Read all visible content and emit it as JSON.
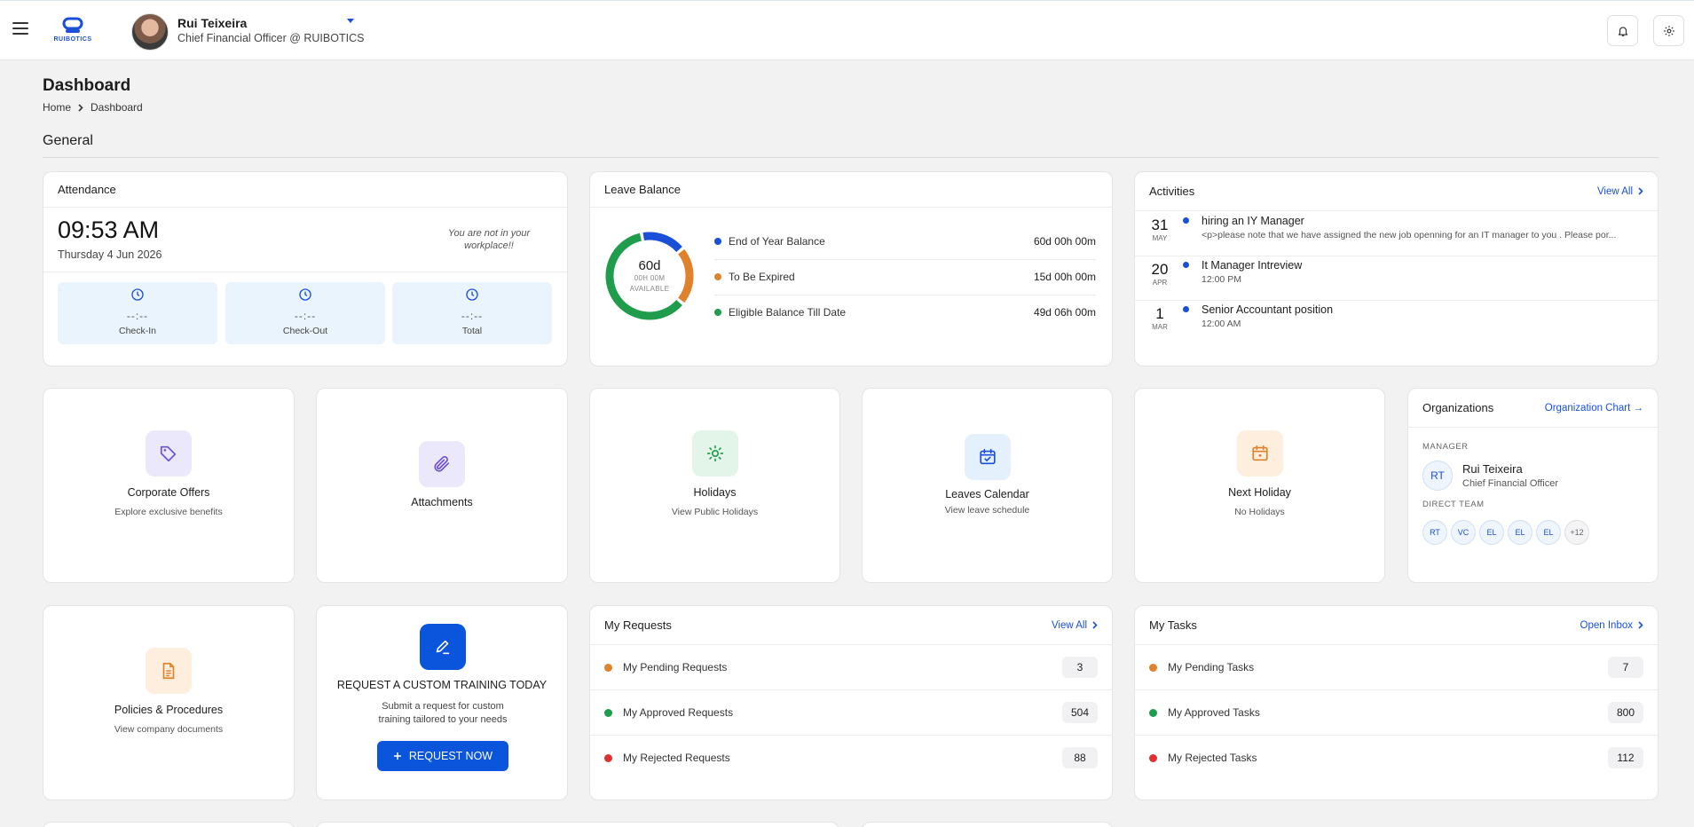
{
  "header": {
    "logo_text": "RUIBOTICS",
    "user_name": "Rui Teixeira",
    "user_role": "Chief Financial Officer @ RUIBOTICS"
  },
  "page": {
    "title": "Dashboard",
    "breadcrumb": [
      "Home",
      "Dashboard"
    ],
    "section": "General"
  },
  "attendance": {
    "title": "Attendance",
    "time": "09:53 AM",
    "date": "Thursday 4 Jun 2026",
    "note": "You are not in your workplace!!",
    "boxes": [
      {
        "value": "--:--",
        "label": "Check-In"
      },
      {
        "value": "--:--",
        "label": "Check-Out"
      },
      {
        "value": "--:--",
        "label": "Total"
      }
    ]
  },
  "leave_balance": {
    "title": "Leave Balance",
    "center_value": "60d",
    "center_sub1": "00H 00M",
    "center_sub2": "AVAILABLE",
    "rows": [
      {
        "label": "End of Year Balance",
        "value": "60d 00h 00m",
        "color": "#1a4fd8"
      },
      {
        "label": "To Be Expired",
        "value": "15d 00h 00m",
        "color": "#e0822c"
      },
      {
        "label": "Eligible Balance Till Date",
        "value": "49d 06h 00m",
        "color": "#1f9d4c"
      }
    ],
    "donut_fractions": {
      "blue": 0.17,
      "orange": 0.22,
      "green": 0.61
    }
  },
  "activities": {
    "title": "Activities",
    "view_all": "View All",
    "items": [
      {
        "day": "31",
        "month": "MAY",
        "title": "hiring an IY Manager",
        "sub": "<p>please note that we have assigned the new job openning for an IT manager to you . Please por..."
      },
      {
        "day": "20",
        "month": "APR",
        "title": "It Manager Intreview",
        "sub": "12:00 PM"
      },
      {
        "day": "1",
        "month": "MAR",
        "title": "Senior Accountant position",
        "sub": "12:00 AM"
      }
    ]
  },
  "tiles": {
    "corporate": {
      "title": "Corporate Offers",
      "sub": "Explore exclusive benefits"
    },
    "attachments": {
      "title": "Attachments"
    },
    "holidays": {
      "title": "Holidays",
      "sub": "View Public Holidays"
    },
    "leaves_calendar": {
      "title": "Leaves Calendar",
      "sub": "View leave schedule"
    },
    "next_holiday": {
      "title": "Next Holiday",
      "sub": "No Holidays"
    },
    "policies": {
      "title": "Policies & Procedures",
      "sub": "View company documents"
    }
  },
  "organizations": {
    "title": "Organizations",
    "chart_link": "Organization Chart →",
    "manager_label": "MANAGER",
    "manager_initials": "RT",
    "manager_name": "Rui Teixeira",
    "manager_role": "Chief Financial Officer",
    "team_label": "DIRECT TEAM",
    "team": [
      "RT",
      "VC",
      "EL",
      "EL",
      "EL",
      "+12"
    ]
  },
  "training": {
    "title": "REQUEST A CUSTOM TRAINING TODAY",
    "sub": "Submit a request for custom training tailored to your needs",
    "button": "REQUEST NOW"
  },
  "requests": {
    "title": "My Requests",
    "link": "View All",
    "rows": [
      {
        "label": "My Pending Requests",
        "value": "3",
        "color": "#e0822c"
      },
      {
        "label": "My Approved Requests",
        "value": "504",
        "color": "#1f9d4c"
      },
      {
        "label": "My Rejected Requests",
        "value": "88",
        "color": "#e03131"
      }
    ]
  },
  "tasks": {
    "title": "My Tasks",
    "link": "Open Inbox",
    "rows": [
      {
        "label": "My Pending Tasks",
        "value": "7",
        "color": "#e0822c"
      },
      {
        "label": "My Approved Tasks",
        "value": "800",
        "color": "#1f9d4c"
      },
      {
        "label": "My Rejected Tasks",
        "value": "112",
        "color": "#e03131"
      }
    ]
  }
}
